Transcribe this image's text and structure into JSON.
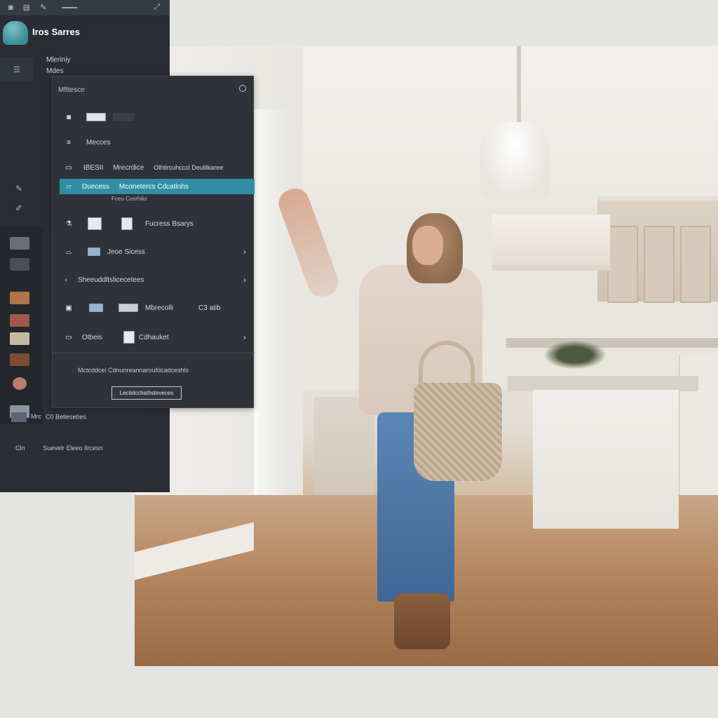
{
  "toolbar": {
    "icons": [
      "image-icon",
      "list-icon",
      "tag-icon",
      "minus-icon",
      "expand-icon"
    ],
    "glyphs": [
      "◙",
      "▤",
      "✎",
      "⤢"
    ]
  },
  "app": {
    "title": "Iros Sarres",
    "sub_label_1": "Mleriniy",
    "sub_label_2": "Mdes",
    "rail_glyph": "☰"
  },
  "menu": {
    "header": "Mfttesce",
    "rows": [
      {
        "label": "",
        "icon": "camera-icon"
      },
      {
        "label": "Mecces",
        "icon": "stack-icon"
      },
      {
        "label": "IBESII",
        "label2": "Mrecrdice",
        "label3": "Olhtlrcuhcccl Deulilkaree",
        "icon": "card-icon"
      },
      {
        "label": "Duecess",
        "label2": "Mconetercs Cdcatlnhs",
        "icon": "folder-icon",
        "selected": true
      },
      {
        "label": "Fucress Bsarys",
        "icon": "flask-icon"
      },
      {
        "label": "Jeoe Sicess",
        "icon": "hat-icon"
      },
      {
        "label": "Sheeuddltslicecetees",
        "icon": "back-icon"
      },
      {
        "label": "Mbrecolli",
        "label2": "C3 atib",
        "icon": "image-icon"
      },
      {
        "label": "Otbeis",
        "label2": "Cdhauket",
        "icon": "card-icon"
      }
    ],
    "sub_caption": "Fceu Cosrhiiis",
    "footer_text": "Mctcddcei Cdnunreannaroufdcadceshls",
    "footer_button": "Lectidcchathsteveces"
  },
  "bottom": {
    "row1_code": "Mrc",
    "row1_text": "C0 Bellesebes",
    "row2_glyph": "Cln",
    "row2_text": "Suevelr Eleeo Ilrcesn"
  },
  "colors": {
    "accent": "#2f8ea4",
    "panel": "#2f3238",
    "background": "#e4e5e2"
  }
}
